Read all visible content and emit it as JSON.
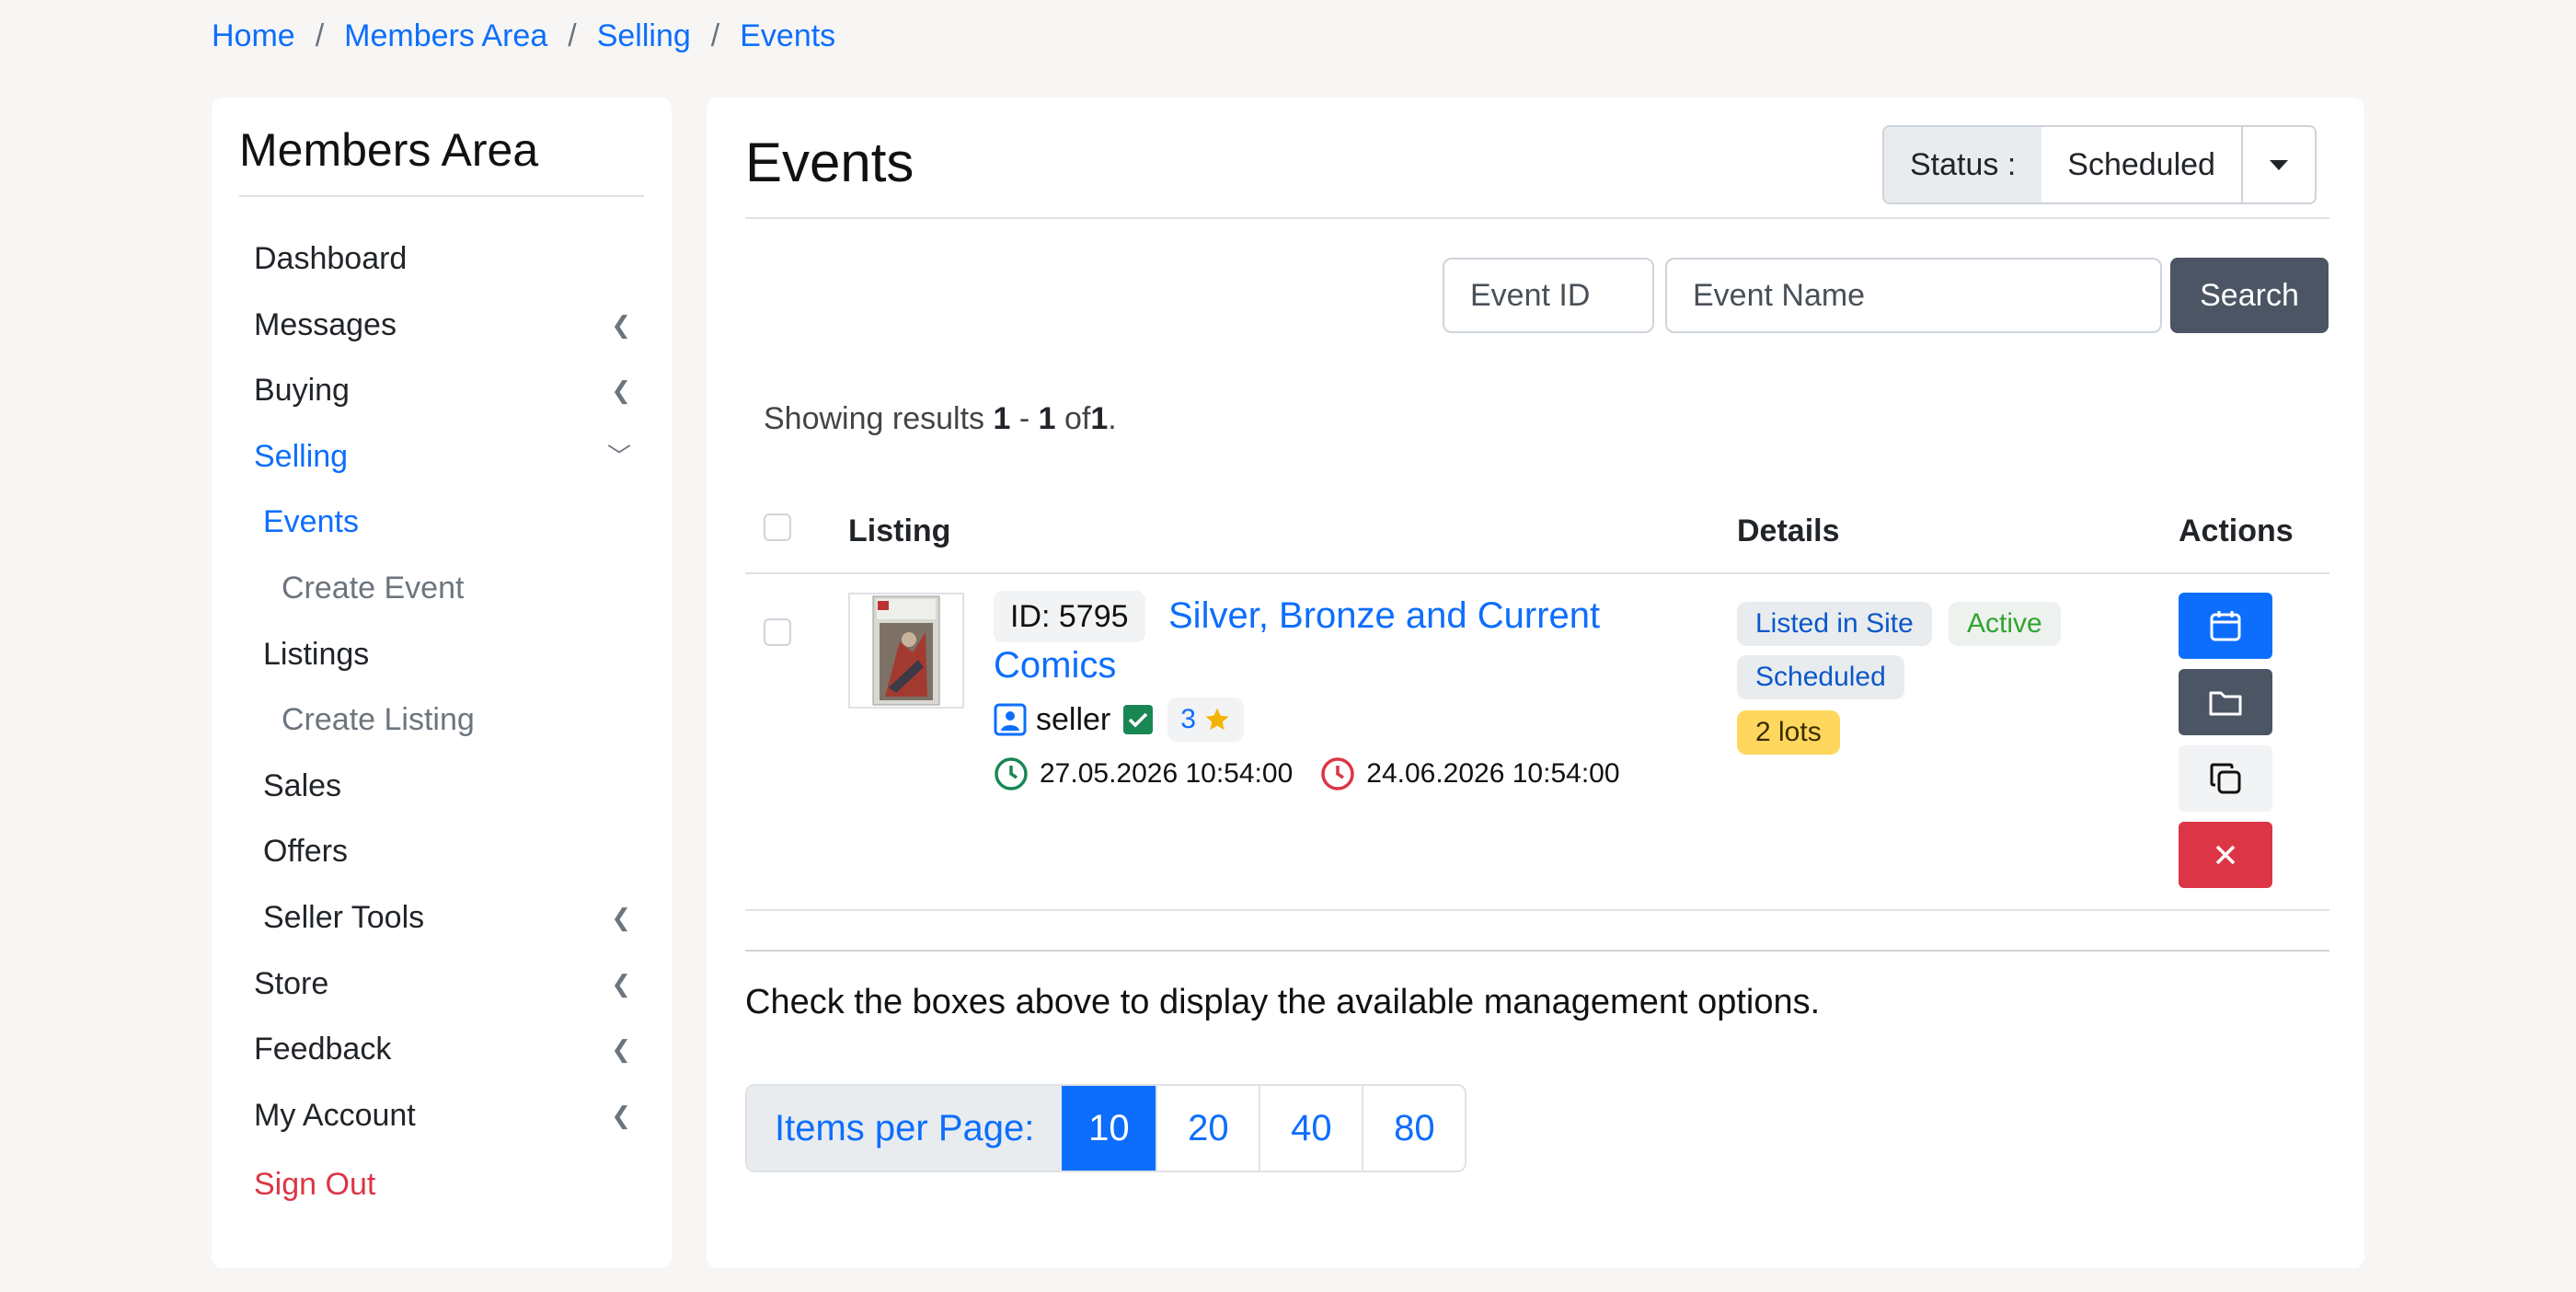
{
  "breadcrumb": [
    "Home",
    "Members Area",
    "Selling",
    "Events"
  ],
  "sidebar": {
    "title": "Members Area",
    "items": [
      {
        "label": "Dashboard",
        "level": 0,
        "chevron": ""
      },
      {
        "label": "Messages",
        "level": 0,
        "chevron": "<"
      },
      {
        "label": "Buying",
        "level": 0,
        "chevron": "<"
      },
      {
        "label": "Selling",
        "level": 0,
        "chevron": "v",
        "active": true
      },
      {
        "label": "Events",
        "level": 1,
        "active": true
      },
      {
        "label": "Create Event",
        "level": 2
      },
      {
        "label": "Listings",
        "level": 1
      },
      {
        "label": "Create Listing",
        "level": 2
      },
      {
        "label": "Sales",
        "level": 1
      },
      {
        "label": "Offers",
        "level": 1
      },
      {
        "label": "Seller Tools",
        "level": 1,
        "chevron": "<"
      },
      {
        "label": "Store",
        "level": 0,
        "chevron": "<"
      },
      {
        "label": "Feedback",
        "level": 0,
        "chevron": "<"
      },
      {
        "label": "My Account",
        "level": 0,
        "chevron": "<"
      }
    ],
    "sign_out": "Sign Out"
  },
  "main": {
    "title": "Events",
    "status": {
      "label": "Status :",
      "value": "Scheduled"
    },
    "search": {
      "event_id_placeholder": "Event ID",
      "event_name_placeholder": "Event Name",
      "button": "Search"
    },
    "results": {
      "prefix": "Showing results",
      "from": "1",
      "dash": "-",
      "to": "1",
      "of": "of",
      "total": "1",
      "suffix": "."
    },
    "table": {
      "headers": {
        "listing": "Listing",
        "details": "Details",
        "actions": "Actions"
      },
      "rows": [
        {
          "id": "ID: 5795",
          "title": "Silver, Bronze and Current Comics",
          "seller": "seller",
          "rating": "3",
          "start": "27.05.2026 10:54:00",
          "end": "24.06.2026 10:54:00",
          "badges": {
            "listed": "Listed in Site",
            "active": "Active",
            "scheduled": "Scheduled",
            "lots": "2 lots"
          }
        }
      ]
    },
    "notice": "Check the boxes above to display the available management options.",
    "per_page": {
      "label": "Items per Page:",
      "options": [
        "10",
        "20",
        "40",
        "80"
      ],
      "selected": "10"
    }
  },
  "colors": {
    "accent": "#0d6efd",
    "danger": "#dc3545",
    "success": "#28a745",
    "warning": "#ffd75e",
    "dark_button": "#4b5563"
  }
}
